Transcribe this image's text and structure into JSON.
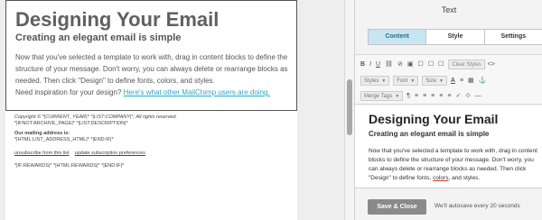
{
  "preview": {
    "heading": "Designing Your Email",
    "subheading": "Creating an elegant email is simple",
    "paragraph": "Now that you've selected a template to work with, drag in content blocks to define the structure of your message. Don't worry, you can always delete or rearrange blocks as needed. Then click \"Design\" to define fonts, colors, and styles.",
    "inspiration_text": "Need inspiration for your design?",
    "inspiration_link": "Here's what other MailChimp users are doing.",
    "footer": {
      "copyright": "Copyright © *|CURRENT_YEAR|* *|LIST:COMPANY|*, All rights reserved.",
      "archive": "*|IFNOT:ARCHIVE_PAGE|* *|LIST:DESCRIPTION|*",
      "mailing_label": "Our mailing address is:",
      "address": "*|HTML:LIST_ADDRESS_HTML|* *|END:IF|*",
      "unsubscribe": "unsubscribe from this list",
      "update_prefs": "update subscription preferences",
      "rewards": "*|IF:REWARDS|* *|HTML:REWARDS|* *|END:IF|*"
    }
  },
  "panel": {
    "title": "Text",
    "tabs": [
      "Content",
      "Style",
      "Settings"
    ],
    "toolbar": {
      "row1": [
        "B",
        "I",
        "U",
        "⛓",
        "⊘",
        "▣",
        "☐",
        "☐",
        "☐"
      ],
      "clear_styles": "Clear Styles",
      "code": "<>",
      "styles": "Styles",
      "font": "Font",
      "size": "Size",
      "font_color": "A",
      "row2_icons": [
        "≡",
        "▦",
        "⚓"
      ],
      "merge_tags": "Merge Tags",
      "row3_icons": [
        "¶",
        "≡",
        "≡",
        "≡",
        "≡",
        "≡",
        "✓",
        "⟐",
        "—"
      ]
    },
    "editor": {
      "heading": "Designing Your Email",
      "subheading": "Creating an elegant email is simple",
      "paragraph_start": "Now that you've selected a template to work with, drag in content blocks to define the structure of your message. Don't worry, you can always delete or rearrange blocks as needed. Then click \"Design\" to define fonts, ",
      "paragraph_underlined": "colors",
      "paragraph_end": ", and styles."
    },
    "save_button": "Save & Close",
    "autosave": "We'll autosave every 20 seconds"
  }
}
